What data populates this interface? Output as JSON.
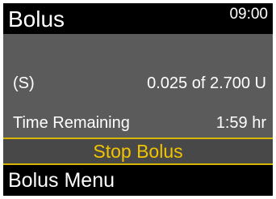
{
  "header": {
    "title": "Bolus",
    "time": "09:00"
  },
  "bolus": {
    "status_label": "(S)",
    "progress": "0.025 of 2.700 U",
    "delivered_units": 0.025,
    "total_units": 2.7,
    "time_remaining_label": "Time Remaining",
    "time_remaining_value": "1:59 hr"
  },
  "actions": {
    "stop_bolus": "Stop Bolus",
    "bolus_menu": "Bolus Menu"
  },
  "colors": {
    "screen_background": "#5b5b5b",
    "title_bar": "#000000",
    "selection_accent": "#f2c400"
  }
}
